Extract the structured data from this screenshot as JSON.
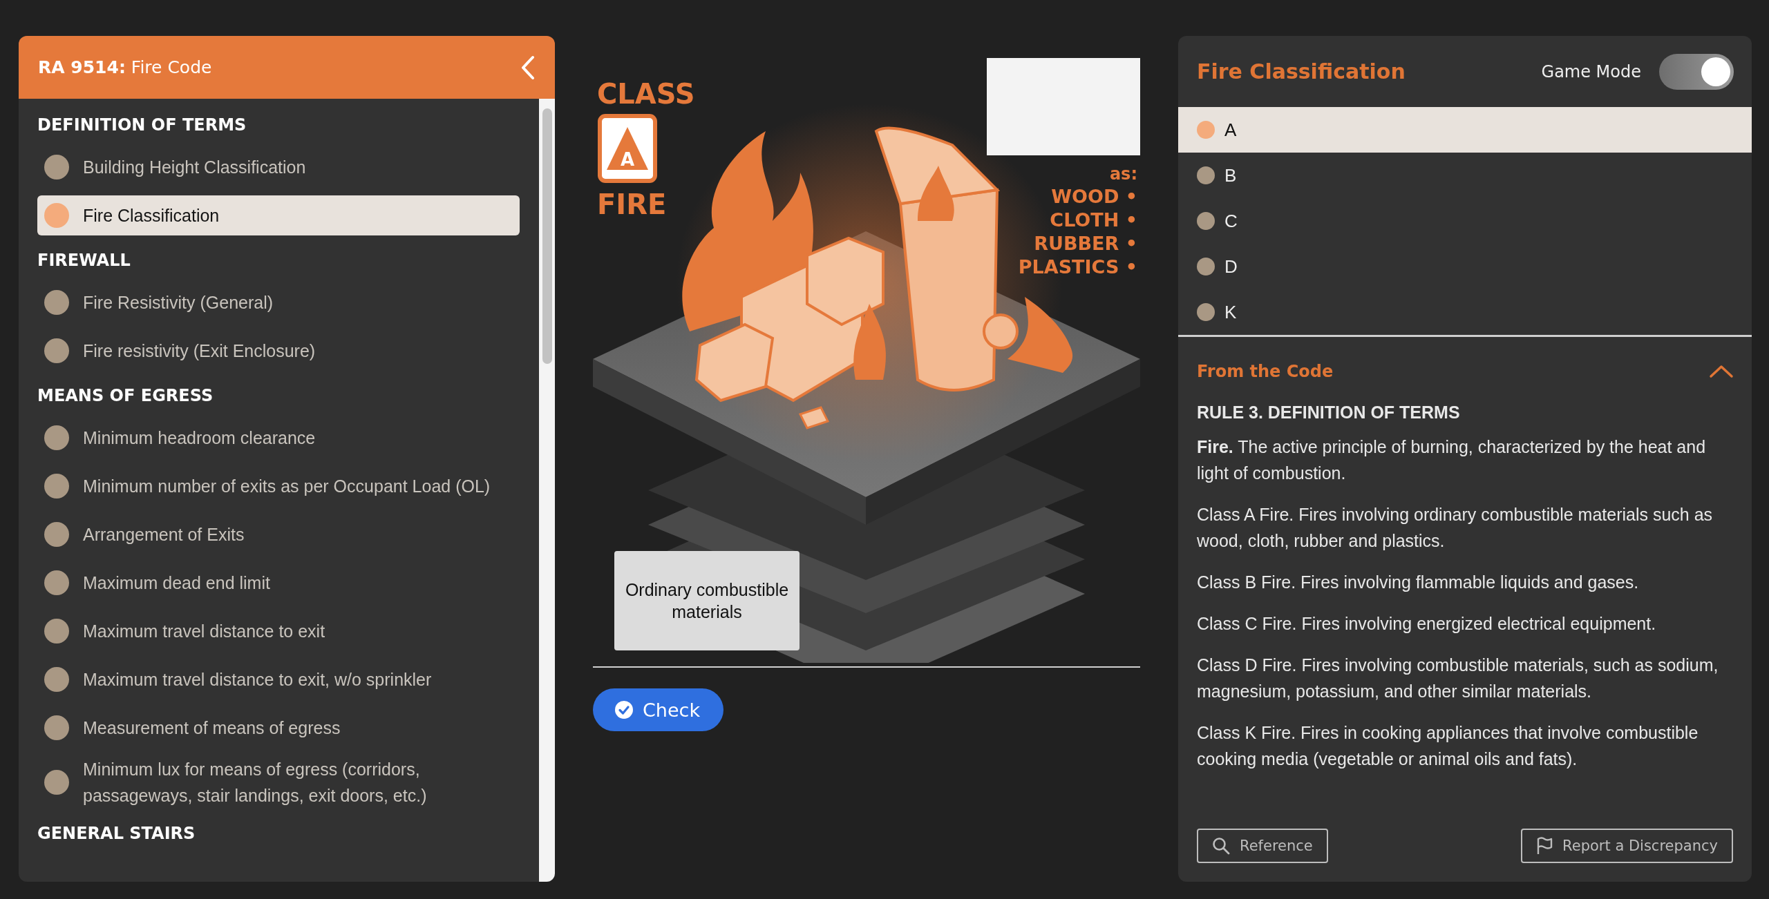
{
  "sidebar": {
    "title": "**RA 9514:** Fire Code",
    "sections": [
      {
        "heading": "DEFINITION OF TERMS",
        "items": [
          {
            "label": "Building Height Classification",
            "selected": false
          },
          {
            "label": "Fire Classification",
            "selected": true
          }
        ]
      },
      {
        "heading": "FIREWALL",
        "items": [
          {
            "label": "Fire Resistivity (General)",
            "selected": false
          },
          {
            "label": "Fire resistivity (Exit Enclosure)",
            "selected": false
          }
        ]
      },
      {
        "heading": "MEANS OF EGRESS",
        "items": [
          {
            "label": "Minimum headroom clearance",
            "selected": false
          },
          {
            "label": "Minimum number of exits as per Occupant Load (OL)",
            "selected": false
          },
          {
            "label": "Arrangement of Exits",
            "selected": false
          },
          {
            "label": "Maximum dead end limit",
            "selected": false
          },
          {
            "label": "Maximum travel distance to exit",
            "selected": false
          },
          {
            "label": "Maximum travel distance to exit, w/o sprinkler",
            "selected": false
          },
          {
            "label": "Measurement of means of egress",
            "selected": false
          },
          {
            "label": "Minimum lux for means of egress (corridors, passageways, stair landings, exit doors, etc.)",
            "selected": false
          }
        ]
      },
      {
        "heading": "GENERAL STAIRS"
      }
    ]
  },
  "scene": {
    "badge_top": "CLASS",
    "badge_letter": "A",
    "badge_bottom": "FIRE",
    "materials_intro": "as:",
    "materials": [
      "WOOD •",
      "CLOTH •",
      "RUBBER •",
      "PLASTICS •"
    ],
    "answer_card": "Ordinary combustible materials",
    "check_button": "Check"
  },
  "classification": {
    "title": "Fire Classification",
    "game_mode": {
      "label": "Game Mode",
      "on": true
    },
    "classes": [
      {
        "label": "A",
        "selected": true
      },
      {
        "label": "B",
        "selected": false
      },
      {
        "label": "C",
        "selected": false
      },
      {
        "label": "D",
        "selected": false
      },
      {
        "label": "K",
        "selected": false
      }
    ],
    "code": {
      "title": "From the Code",
      "expanded": true,
      "rule": "RULE 3. DEFINITION OF TERMS",
      "paragraphs": [
        "**Fire.** The active principle of burning, characterized by the heat and light of combustion.",
        "Class A Fire. Fires involving ordinary combustible materials such as wood, cloth, rubber and plastics.",
        "Class B Fire. Fires involving flammable liquids and gases.",
        "Class C Fire. Fires involving energized electrical equipment.",
        "Class D Fire. Fires involving combustible materials, such as sodium, magnesium, potassium, and other similar materials.",
        "Class K Fire. Fires in cooking appliances that involve combustible cooking media (vegetable or animal oils and fats)."
      ]
    },
    "reference_button": "Reference",
    "report_button": "Report a Discrepancy"
  }
}
